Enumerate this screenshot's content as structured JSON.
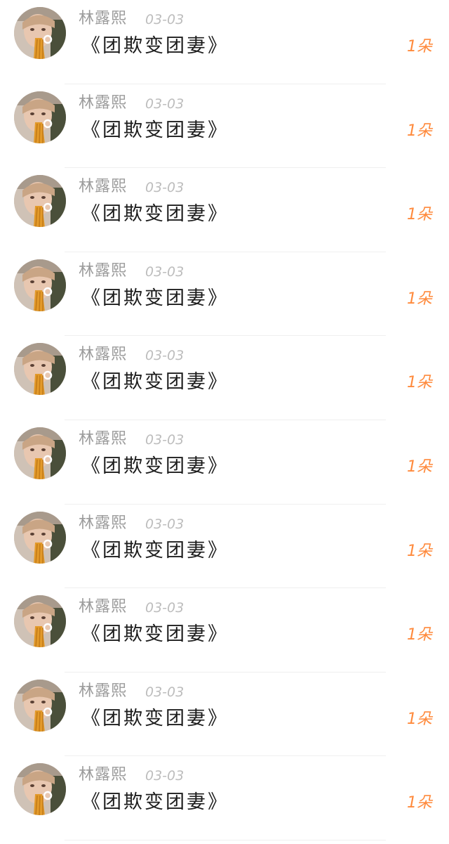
{
  "items": [
    {
      "name": "林露熙",
      "date": "03-03",
      "title": "《团欺变团妻》",
      "gift": "1朵"
    },
    {
      "name": "林露熙",
      "date": "03-03",
      "title": "《团欺变团妻》",
      "gift": "1朵"
    },
    {
      "name": "林露熙",
      "date": "03-03",
      "title": "《团欺变团妻》",
      "gift": "1朵"
    },
    {
      "name": "林露熙",
      "date": "03-03",
      "title": "《团欺变团妻》",
      "gift": "1朵"
    },
    {
      "name": "林露熙",
      "date": "03-03",
      "title": "《团欺变团妻》",
      "gift": "1朵"
    },
    {
      "name": "林露熙",
      "date": "03-03",
      "title": "《团欺变团妻》",
      "gift": "1朵"
    },
    {
      "name": "林露熙",
      "date": "03-03",
      "title": "《团欺变团妻》",
      "gift": "1朵"
    },
    {
      "name": "林露熙",
      "date": "03-03",
      "title": "《团欺变团妻》",
      "gift": "1朵"
    },
    {
      "name": "林露熙",
      "date": "03-03",
      "title": "《团欺变团妻》",
      "gift": "1朵"
    },
    {
      "name": "林露熙",
      "date": "03-03",
      "title": "《团欺变团妻》",
      "gift": "1朵"
    }
  ],
  "colors": {
    "name": "#9b9b9b",
    "date": "#bdbdbd",
    "title": "#1d1d1d",
    "gift": "#ff8a3c",
    "divider": "#efefef"
  },
  "icons": {
    "avatar": "user-avatar-photo"
  }
}
